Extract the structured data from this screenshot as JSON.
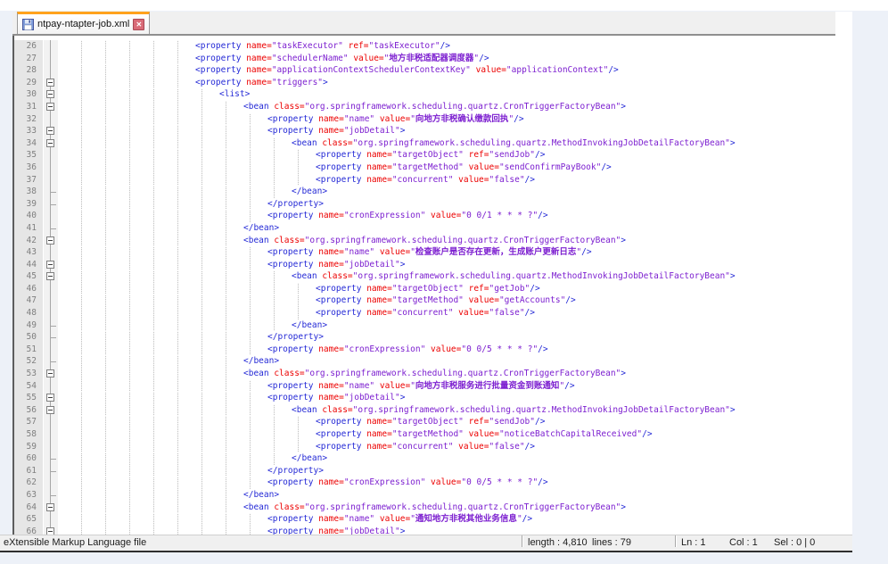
{
  "tab": {
    "title": "ntpay-ntapter-job.xml"
  },
  "icons": {
    "save_icon": "floppy-disk",
    "close_icon": "x-close"
  },
  "colors": {
    "tab_accent_orange": "#ffa21c",
    "close_button_red": "#d96b77",
    "tag_blue": "#2429d6",
    "attribute_red": "#ec0000",
    "value_purple": "#7d20d0",
    "gutter_bg": "#e6e6e6",
    "line_number_gray": "#7f7f7f",
    "page_bg": "#edf1f8"
  },
  "status_bar": {
    "doc_type": "eXtensible Markup Language file",
    "length_label": "length : 4,810",
    "lines_label": "lines : 79",
    "ln": "Ln : 1",
    "col": "Col : 1",
    "sel": "Sel : 0 | 0"
  },
  "editor": {
    "first_visible_line": 26,
    "last_visible_line": 66,
    "lines": [
      {
        "n": 26,
        "lvl": 2,
        "fold": "none",
        "tk": [
          [
            "g",
            "<property "
          ],
          [
            "a",
            "name="
          ],
          [
            "v",
            "\"taskExecutor\""
          ],
          [
            "a",
            " ref="
          ],
          [
            "v",
            "\"taskExecutor\""
          ],
          [
            "g",
            "/>"
          ]
        ]
      },
      {
        "n": 27,
        "lvl": 2,
        "fold": "none",
        "tk": [
          [
            "g",
            "<property "
          ],
          [
            "a",
            "name="
          ],
          [
            "v",
            "\"schedulerName\""
          ],
          [
            "a",
            " value="
          ],
          [
            "v",
            "\""
          ],
          [
            "c",
            "地方非税适配器调度器"
          ],
          [
            "v",
            "\""
          ],
          [
            "g",
            "/>"
          ]
        ]
      },
      {
        "n": 28,
        "lvl": 2,
        "fold": "none",
        "tk": [
          [
            "g",
            "<property "
          ],
          [
            "a",
            "name="
          ],
          [
            "v",
            "\"applicationContextSchedulerContextKey\""
          ],
          [
            "a",
            " value="
          ],
          [
            "v",
            "\"applicationContext\""
          ],
          [
            "g",
            "/>"
          ]
        ]
      },
      {
        "n": 29,
        "lvl": 2,
        "fold": "box",
        "tk": [
          [
            "g",
            "<property "
          ],
          [
            "a",
            "name="
          ],
          [
            "v",
            "\"triggers\""
          ],
          [
            "g",
            ">"
          ]
        ]
      },
      {
        "n": 30,
        "lvl": 3,
        "fold": "box",
        "tk": [
          [
            "g",
            "<list>"
          ]
        ]
      },
      {
        "n": 31,
        "lvl": 4,
        "fold": "box",
        "tk": [
          [
            "g",
            "<bean "
          ],
          [
            "a",
            "class="
          ],
          [
            "v",
            "\"org.springframework.scheduling.quartz.CronTriggerFactoryBean\""
          ],
          [
            "g",
            ">"
          ]
        ]
      },
      {
        "n": 32,
        "lvl": 5,
        "fold": "none",
        "tk": [
          [
            "g",
            "<property "
          ],
          [
            "a",
            "name="
          ],
          [
            "v",
            "\"name\""
          ],
          [
            "a",
            " value="
          ],
          [
            "v",
            "\""
          ],
          [
            "c",
            "向地方非税确认缴款回执"
          ],
          [
            "v",
            "\""
          ],
          [
            "g",
            "/>"
          ]
        ]
      },
      {
        "n": 33,
        "lvl": 5,
        "fold": "box",
        "tk": [
          [
            "g",
            "<property "
          ],
          [
            "a",
            "name="
          ],
          [
            "v",
            "\"jobDetail\""
          ],
          [
            "g",
            ">"
          ]
        ]
      },
      {
        "n": 34,
        "lvl": 6,
        "fold": "box",
        "tk": [
          [
            "g",
            "<bean "
          ],
          [
            "a",
            "class="
          ],
          [
            "v",
            "\"org.springframework.scheduling.quartz.MethodInvokingJobDetailFactoryBean\""
          ],
          [
            "g",
            ">"
          ]
        ]
      },
      {
        "n": 35,
        "lvl": 7,
        "fold": "none",
        "tk": [
          [
            "g",
            "<property "
          ],
          [
            "a",
            "name="
          ],
          [
            "v",
            "\"targetObject\""
          ],
          [
            "a",
            " ref="
          ],
          [
            "v",
            "\"sendJob\""
          ],
          [
            "g",
            "/>"
          ]
        ]
      },
      {
        "n": 36,
        "lvl": 7,
        "fold": "none",
        "tk": [
          [
            "g",
            "<property "
          ],
          [
            "a",
            "name="
          ],
          [
            "v",
            "\"targetMethod\""
          ],
          [
            "a",
            " value="
          ],
          [
            "v",
            "\"sendConfirmPayBook\""
          ],
          [
            "g",
            "/>"
          ]
        ]
      },
      {
        "n": 37,
        "lvl": 7,
        "fold": "none",
        "tk": [
          [
            "g",
            "<property "
          ],
          [
            "a",
            "name="
          ],
          [
            "v",
            "\"concurrent\""
          ],
          [
            "a",
            " value="
          ],
          [
            "v",
            "\"false\""
          ],
          [
            "g",
            "/>"
          ]
        ]
      },
      {
        "n": 38,
        "lvl": 6,
        "fold": "end",
        "tk": [
          [
            "g",
            "</bean>"
          ]
        ]
      },
      {
        "n": 39,
        "lvl": 5,
        "fold": "end",
        "tk": [
          [
            "g",
            "</property>"
          ]
        ]
      },
      {
        "n": 40,
        "lvl": 5,
        "fold": "none",
        "tk": [
          [
            "g",
            "<property "
          ],
          [
            "a",
            "name="
          ],
          [
            "v",
            "\"cronExpression\""
          ],
          [
            "a",
            " value="
          ],
          [
            "v",
            "\"0 0/1 * * * ?\""
          ],
          [
            "g",
            "/>"
          ]
        ]
      },
      {
        "n": 41,
        "lvl": 4,
        "fold": "end",
        "tk": [
          [
            "g",
            "</bean>"
          ]
        ]
      },
      {
        "n": 42,
        "lvl": 4,
        "fold": "box",
        "tk": [
          [
            "g",
            "<bean "
          ],
          [
            "a",
            "class="
          ],
          [
            "v",
            "\"org.springframework.scheduling.quartz.CronTriggerFactoryBean\""
          ],
          [
            "g",
            ">"
          ]
        ]
      },
      {
        "n": 43,
        "lvl": 5,
        "fold": "none",
        "tk": [
          [
            "g",
            "<property "
          ],
          [
            "a",
            "name="
          ],
          [
            "v",
            "\"name\""
          ],
          [
            "a",
            " value="
          ],
          [
            "v",
            "\""
          ],
          [
            "c",
            "检查账户是否存在更新，生成账户更新日志"
          ],
          [
            "v",
            "\""
          ],
          [
            "g",
            "/>"
          ]
        ]
      },
      {
        "n": 44,
        "lvl": 5,
        "fold": "box",
        "tk": [
          [
            "g",
            "<property "
          ],
          [
            "a",
            "name="
          ],
          [
            "v",
            "\"jobDetail\""
          ],
          [
            "g",
            ">"
          ]
        ]
      },
      {
        "n": 45,
        "lvl": 6,
        "fold": "box",
        "tk": [
          [
            "g",
            "<bean "
          ],
          [
            "a",
            "class="
          ],
          [
            "v",
            "\"org.springframework.scheduling.quartz.MethodInvokingJobDetailFactoryBean\""
          ],
          [
            "g",
            ">"
          ]
        ]
      },
      {
        "n": 46,
        "lvl": 7,
        "fold": "none",
        "tk": [
          [
            "g",
            "<property "
          ],
          [
            "a",
            "name="
          ],
          [
            "v",
            "\"targetObject\""
          ],
          [
            "a",
            " ref="
          ],
          [
            "v",
            "\"getJob\""
          ],
          [
            "g",
            "/>"
          ]
        ]
      },
      {
        "n": 47,
        "lvl": 7,
        "fold": "none",
        "tk": [
          [
            "g",
            "<property "
          ],
          [
            "a",
            "name="
          ],
          [
            "v",
            "\"targetMethod\""
          ],
          [
            "a",
            " value="
          ],
          [
            "v",
            "\"getAccounts\""
          ],
          [
            "g",
            "/>"
          ]
        ]
      },
      {
        "n": 48,
        "lvl": 7,
        "fold": "none",
        "tk": [
          [
            "g",
            "<property "
          ],
          [
            "a",
            "name="
          ],
          [
            "v",
            "\"concurrent\""
          ],
          [
            "a",
            " value="
          ],
          [
            "v",
            "\"false\""
          ],
          [
            "g",
            "/>"
          ]
        ]
      },
      {
        "n": 49,
        "lvl": 6,
        "fold": "end",
        "tk": [
          [
            "g",
            "</bean>"
          ]
        ]
      },
      {
        "n": 50,
        "lvl": 5,
        "fold": "end",
        "tk": [
          [
            "g",
            "</property>"
          ]
        ]
      },
      {
        "n": 51,
        "lvl": 5,
        "fold": "none",
        "tk": [
          [
            "g",
            "<property "
          ],
          [
            "a",
            "name="
          ],
          [
            "v",
            "\"cronExpression\""
          ],
          [
            "a",
            " value="
          ],
          [
            "v",
            "\"0 0/5 * * * ?\""
          ],
          [
            "g",
            "/>"
          ]
        ]
      },
      {
        "n": 52,
        "lvl": 4,
        "fold": "end",
        "tk": [
          [
            "g",
            "</bean>"
          ]
        ]
      },
      {
        "n": 53,
        "lvl": 4,
        "fold": "box",
        "tk": [
          [
            "g",
            "<bean "
          ],
          [
            "a",
            "class="
          ],
          [
            "v",
            "\"org.springframework.scheduling.quartz.CronTriggerFactoryBean\""
          ],
          [
            "g",
            ">"
          ]
        ]
      },
      {
        "n": 54,
        "lvl": 5,
        "fold": "none",
        "tk": [
          [
            "g",
            "<property "
          ],
          [
            "a",
            "name="
          ],
          [
            "v",
            "\"name\""
          ],
          [
            "a",
            " value="
          ],
          [
            "v",
            "\""
          ],
          [
            "c",
            "向地方非税服务进行批量资金到账通知"
          ],
          [
            "v",
            "\""
          ],
          [
            "g",
            "/>"
          ]
        ]
      },
      {
        "n": 55,
        "lvl": 5,
        "fold": "box",
        "tk": [
          [
            "g",
            "<property "
          ],
          [
            "a",
            "name="
          ],
          [
            "v",
            "\"jobDetail\""
          ],
          [
            "g",
            ">"
          ]
        ]
      },
      {
        "n": 56,
        "lvl": 6,
        "fold": "box",
        "tk": [
          [
            "g",
            "<bean "
          ],
          [
            "a",
            "class="
          ],
          [
            "v",
            "\"org.springframework.scheduling.quartz.MethodInvokingJobDetailFactoryBean\""
          ],
          [
            "g",
            ">"
          ]
        ]
      },
      {
        "n": 57,
        "lvl": 7,
        "fold": "none",
        "tk": [
          [
            "g",
            "<property "
          ],
          [
            "a",
            "name="
          ],
          [
            "v",
            "\"targetObject\""
          ],
          [
            "a",
            " ref="
          ],
          [
            "v",
            "\"sendJob\""
          ],
          [
            "g",
            "/>"
          ]
        ]
      },
      {
        "n": 58,
        "lvl": 7,
        "fold": "none",
        "tk": [
          [
            "g",
            "<property "
          ],
          [
            "a",
            "name="
          ],
          [
            "v",
            "\"targetMethod\""
          ],
          [
            "a",
            " value="
          ],
          [
            "v",
            "\"noticeBatchCapitalReceived\""
          ],
          [
            "g",
            "/>"
          ]
        ]
      },
      {
        "n": 59,
        "lvl": 7,
        "fold": "none",
        "tk": [
          [
            "g",
            "<property "
          ],
          [
            "a",
            "name="
          ],
          [
            "v",
            "\"concurrent\""
          ],
          [
            "a",
            " value="
          ],
          [
            "v",
            "\"false\""
          ],
          [
            "g",
            "/>"
          ]
        ]
      },
      {
        "n": 60,
        "lvl": 6,
        "fold": "end",
        "tk": [
          [
            "g",
            "</bean>"
          ]
        ]
      },
      {
        "n": 61,
        "lvl": 5,
        "fold": "end",
        "tk": [
          [
            "g",
            "</property>"
          ]
        ]
      },
      {
        "n": 62,
        "lvl": 5,
        "fold": "none",
        "tk": [
          [
            "g",
            "<property "
          ],
          [
            "a",
            "name="
          ],
          [
            "v",
            "\"cronExpression\""
          ],
          [
            "a",
            " value="
          ],
          [
            "v",
            "\"0 0/5 * * * ?\""
          ],
          [
            "g",
            "/>"
          ]
        ]
      },
      {
        "n": 63,
        "lvl": 4,
        "fold": "end",
        "tk": [
          [
            "g",
            "</bean>"
          ]
        ]
      },
      {
        "n": 64,
        "lvl": 4,
        "fold": "box",
        "tk": [
          [
            "g",
            "<bean "
          ],
          [
            "a",
            "class="
          ],
          [
            "v",
            "\"org.springframework.scheduling.quartz.CronTriggerFactoryBean\""
          ],
          [
            "g",
            ">"
          ]
        ]
      },
      {
        "n": 65,
        "lvl": 5,
        "fold": "none",
        "tk": [
          [
            "g",
            "<property "
          ],
          [
            "a",
            "name="
          ],
          [
            "v",
            "\"name\""
          ],
          [
            "a",
            " value="
          ],
          [
            "v",
            "\""
          ],
          [
            "c",
            "通知地方非税其他业务信息"
          ],
          [
            "v",
            "\""
          ],
          [
            "g",
            "/>"
          ]
        ]
      },
      {
        "n": 66,
        "lvl": 5,
        "fold": "box",
        "tk": [
          [
            "g",
            "<property "
          ],
          [
            "a",
            "name="
          ],
          [
            "v",
            "\"jobDetail\""
          ],
          [
            "g",
            ">"
          ]
        ]
      }
    ]
  }
}
